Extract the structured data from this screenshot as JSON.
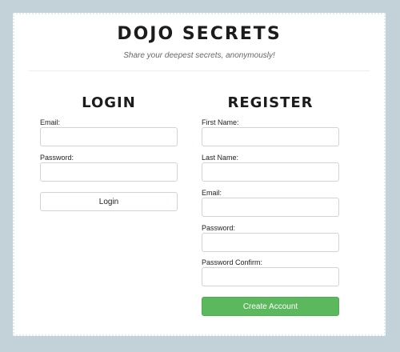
{
  "header": {
    "title": "DOJO SECRETS",
    "subtitle": "Share your deepest secrets, anonymously!"
  },
  "login": {
    "title": "LOGIN",
    "email_label": "Email:",
    "email_value": "",
    "password_label": "Password:",
    "password_value": "",
    "submit_label": "Login"
  },
  "register": {
    "title": "REGISTER",
    "first_name_label": "First Name:",
    "first_name_value": "",
    "last_name_label": "Last Name:",
    "last_name_value": "",
    "email_label": "Email:",
    "email_value": "",
    "password_label": "Password:",
    "password_value": "",
    "password_confirm_label": "Password Confirm:",
    "password_confirm_value": "",
    "submit_label": "Create Account"
  },
  "colors": {
    "background": "#c3d2d8",
    "card": "#ffffff",
    "create_button": "#5cb85c"
  }
}
